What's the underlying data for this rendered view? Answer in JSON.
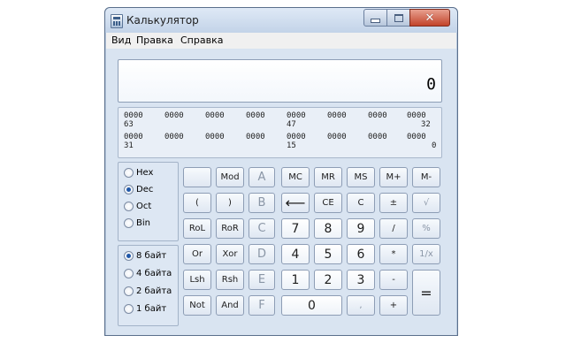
{
  "window": {
    "title": "Калькулятор",
    "close_glyph": "✕"
  },
  "menu": {
    "items": [
      "Вид",
      "Правка",
      "Справка"
    ]
  },
  "display": {
    "value": "0"
  },
  "bits": {
    "row1_groups": [
      "0000",
      "0000",
      "0000",
      "0000",
      "0000",
      "0000",
      "0000",
      "0000"
    ],
    "row1_positions": [
      "63",
      "47",
      "32"
    ],
    "row2_groups": [
      "0000",
      "0000",
      "0000",
      "0000",
      "0000",
      "0000",
      "0000",
      "0000"
    ],
    "row2_positions": [
      "31",
      "15",
      "0"
    ]
  },
  "base_options": [
    {
      "label": "Hex",
      "selected": false
    },
    {
      "label": "Dec",
      "selected": true
    },
    {
      "label": "Oct",
      "selected": false
    },
    {
      "label": "Bin",
      "selected": false
    }
  ],
  "word_options": [
    {
      "label": "8 байт",
      "selected": true
    },
    {
      "label": "4 байта",
      "selected": false
    },
    {
      "label": "2 байта",
      "selected": false
    },
    {
      "label": "1 байт",
      "selected": false
    }
  ],
  "keys": {
    "blank": "",
    "mod": "Mod",
    "A": "A",
    "MC": "MC",
    "MR": "MR",
    "MS": "MS",
    "Mplus": "M+",
    "Mminus": "M-",
    "lparen": "(",
    "rparen": ")",
    "B": "B",
    "backspace": "⟵",
    "CE": "CE",
    "C": "C",
    "plusminus": "±",
    "sqrt": "√",
    "RoL": "RoL",
    "RoR": "RoR",
    "Ckey": "C",
    "n7": "7",
    "n8": "8",
    "n9": "9",
    "div": "/",
    "percent": "%",
    "Or": "Or",
    "Xor": "Xor",
    "D": "D",
    "n4": "4",
    "n5": "5",
    "n6": "6",
    "mul": "*",
    "recip": "1/x",
    "Lsh": "Lsh",
    "Rsh": "Rsh",
    "E": "E",
    "n1": "1",
    "n2": "2",
    "n3": "3",
    "minus": "-",
    "equals": "=",
    "Not": "Not",
    "And": "And",
    "F": "F",
    "n0": "0",
    "dot": ",",
    "plus": "+"
  }
}
